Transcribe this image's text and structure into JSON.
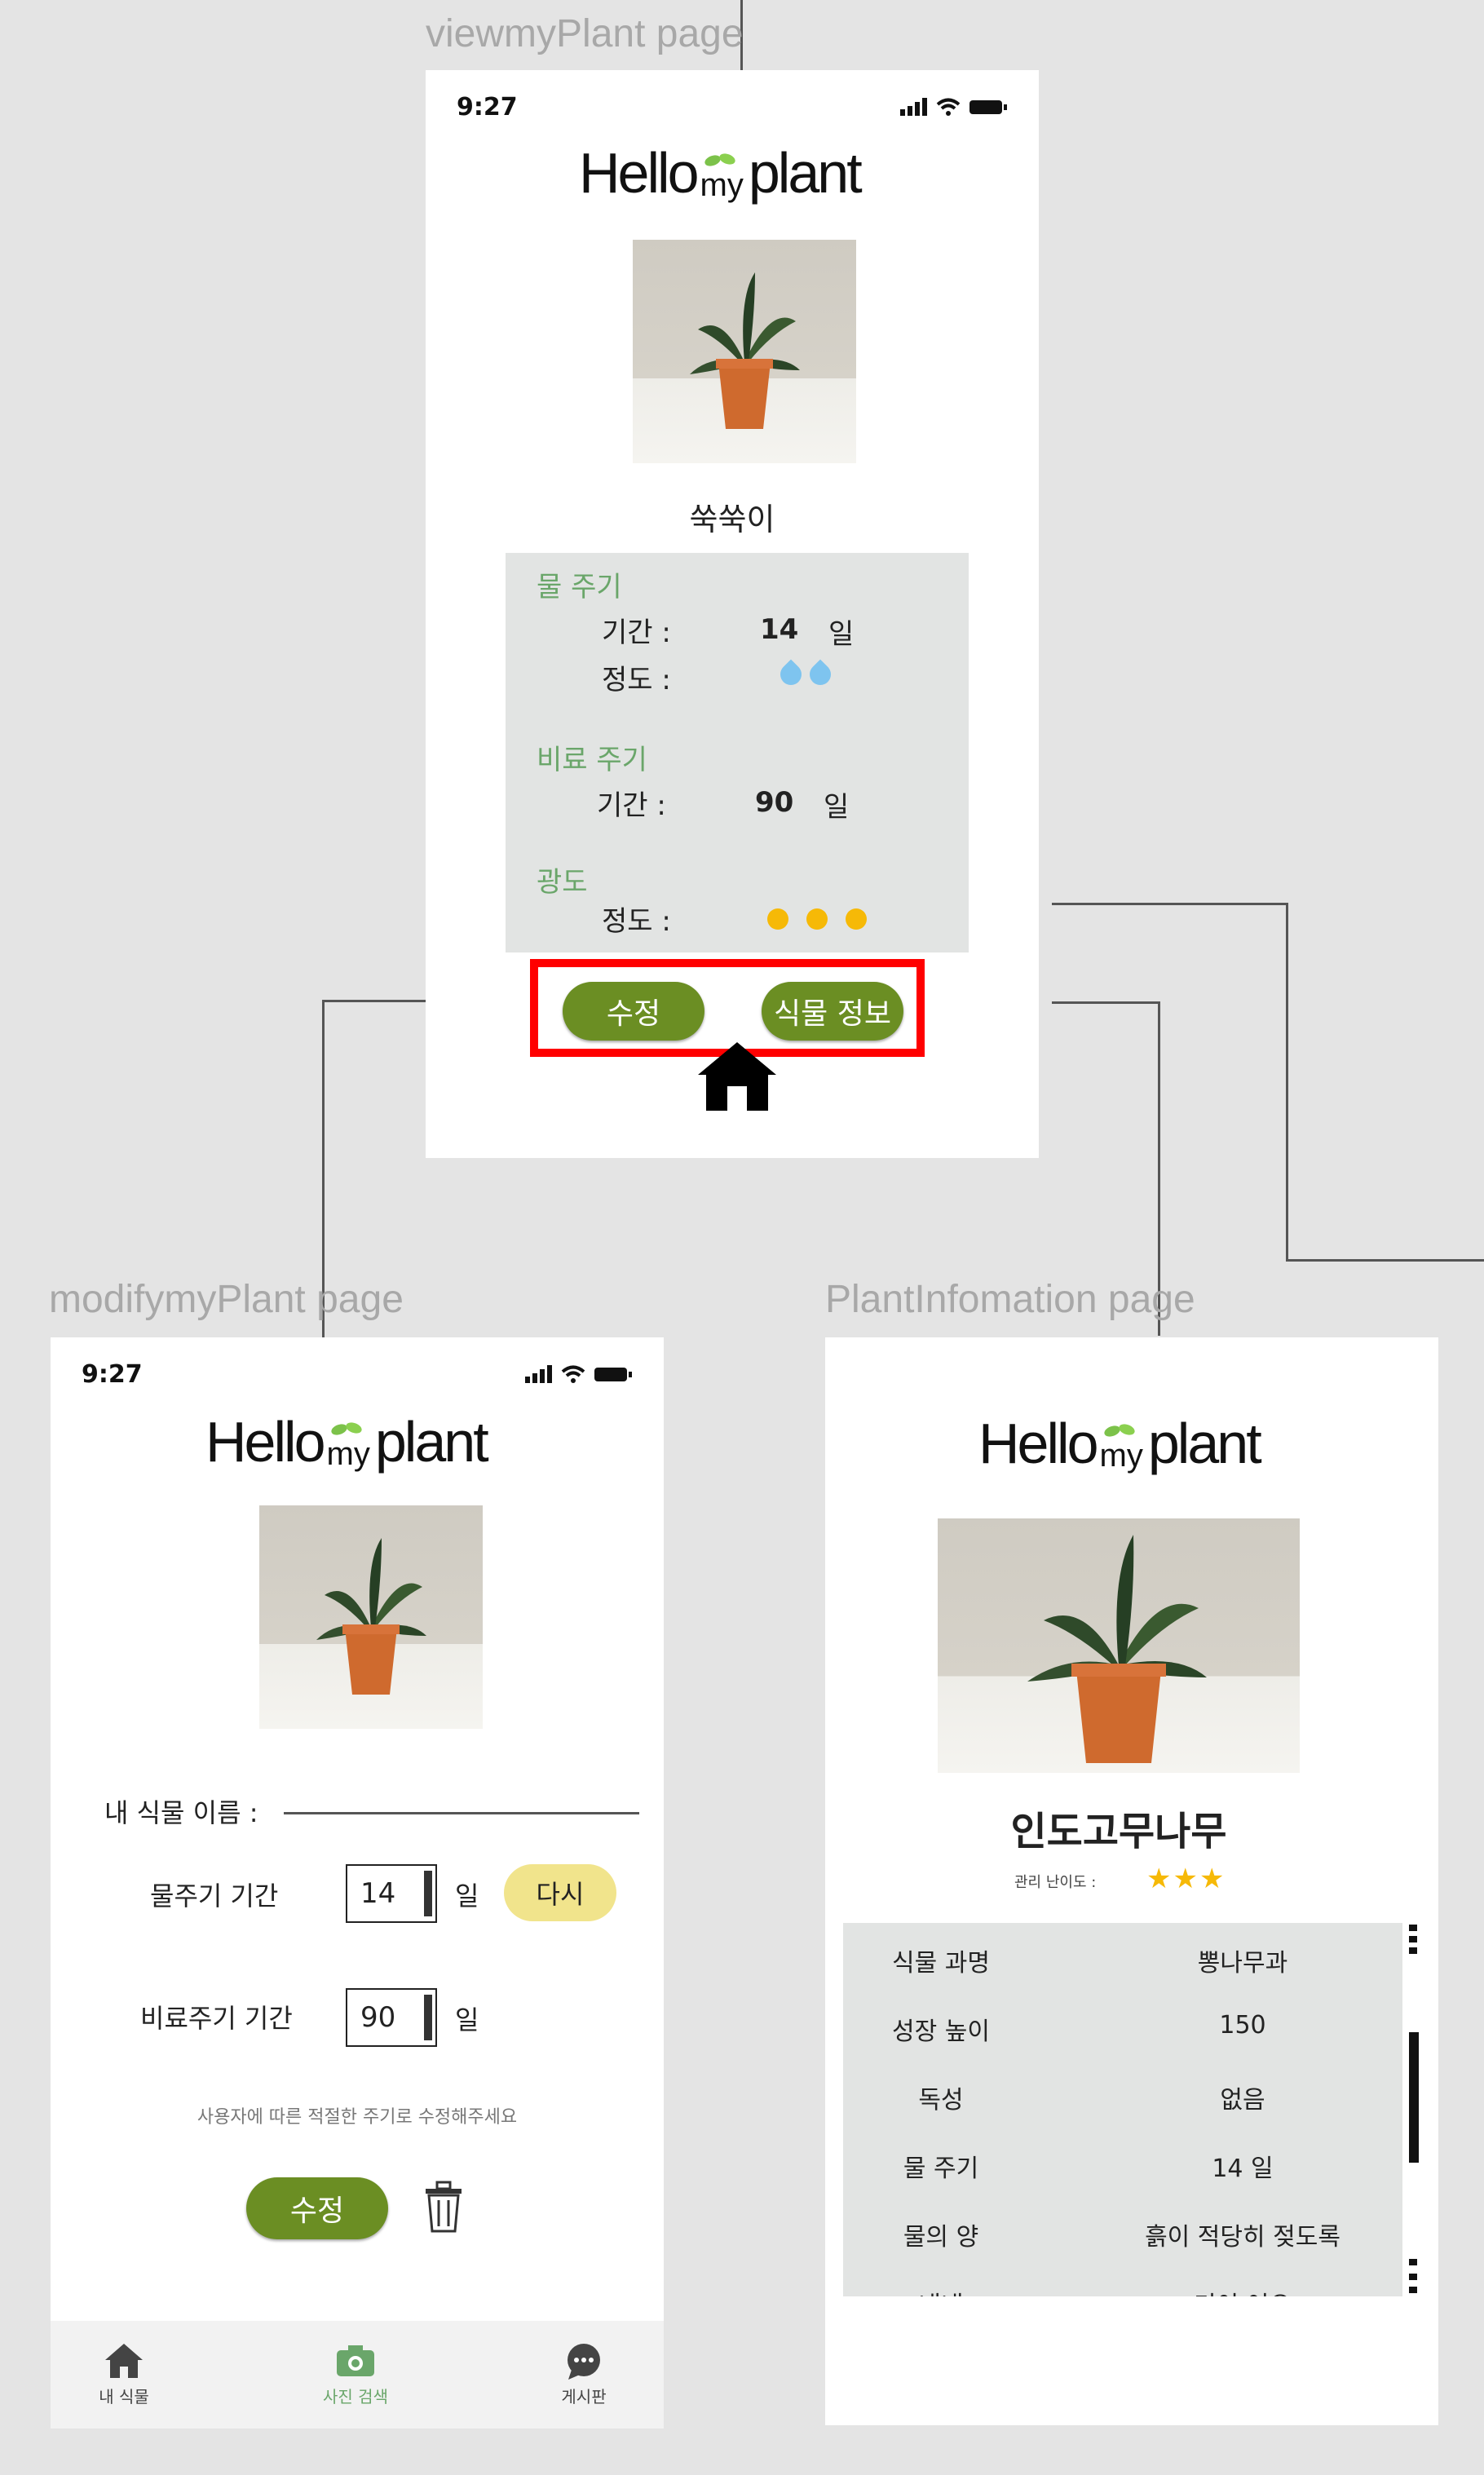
{
  "screens": {
    "view": {
      "label": "viewmyPlant page",
      "time": "9:27",
      "logo": {
        "hello": "Hello",
        "my": "my",
        "plant": "plant"
      },
      "plant_name": "쑥쑥이",
      "water": {
        "title": "물 주기",
        "period_label": "기간 :",
        "period_value": "14",
        "unit": "일",
        "amount_label": "정도 :",
        "amount_level": 2
      },
      "fertilizer": {
        "title": "비료 주기",
        "period_label": "기간 :",
        "period_value": "90",
        "unit": "일"
      },
      "light": {
        "title": "광도",
        "amount_label": "정도 :",
        "level": 3
      },
      "buttons": {
        "edit": "수정",
        "info": "식물 정보"
      }
    },
    "modify": {
      "label": "modifymyPlant page",
      "time": "9:27",
      "logo": {
        "hello": "Hello",
        "my": "my",
        "plant": "plant"
      },
      "name_label": "내 식물 이름 :",
      "water_label": "물주기 기간",
      "water_value": "14",
      "unit": "일",
      "reset": "다시",
      "fert_label": "비료주기 기간",
      "fert_value": "90",
      "hint": "사용자에 따른 적절한 주기로 수정해주세요",
      "edit": "수정",
      "tabs": {
        "home": "내 식물",
        "camera": "사진 검색",
        "board": "게시판"
      }
    },
    "info": {
      "label": "PlantInfomation page",
      "logo": {
        "hello": "Hello",
        "my": "my",
        "plant": "plant"
      },
      "plant_name": "인도고무나무",
      "difficulty_label": "관리 난이도 :",
      "difficulty_stars": 3,
      "rows": [
        {
          "k": "식물 과명",
          "v": "뽕나무과"
        },
        {
          "k": "성장 높이",
          "v": "150"
        },
        {
          "k": "독성",
          "v": "없음"
        },
        {
          "k": "물 주기",
          "v": "14 일"
        },
        {
          "k": "물의 양",
          "v": "흙이 적당히 젖도록"
        },
        {
          "k": "내내",
          "v": "기이 어으"
        }
      ]
    }
  },
  "colors": {
    "accent_green": "#6b8e23",
    "highlight_red": "#ff0000",
    "reset_yellow": "#f1e48c"
  }
}
